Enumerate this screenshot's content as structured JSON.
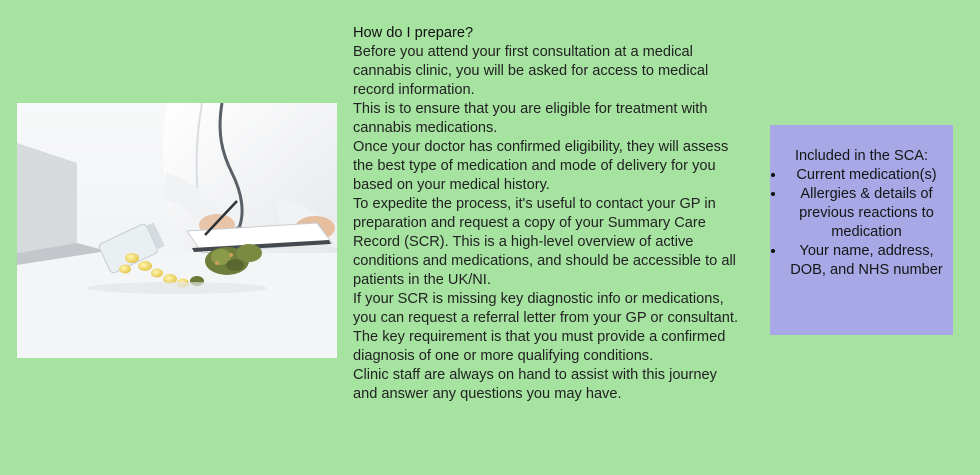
{
  "article": {
    "heading": "How do I prepare?",
    "paragraphs": [
      "Before you attend your first consultation at a medical cannabis clinic, you will be asked for access to medical record information.",
      "This is to ensure that you are eligible for treatment with cannabis medications.",
      "Once your doctor has confirmed eligibility, they will assess the best type of medication and mode of delivery for you based on your medical history.",
      "To expedite the process, it's useful to contact your GP in preparation and request a copy of your Summary Care Record (SCR). This is a high-level overview of active conditions and medications, and should be accessible to all patients in the UK/NI.",
      "If your SCR is missing key diagnostic info or medications, you can request a referral letter from your GP or consultant.",
      "The key requirement is that you must provide a confirmed diagnosis of one or more qualifying conditions.",
      "Clinic staff are always on hand to assist with this journey and answer any questions you may have."
    ]
  },
  "sca": {
    "heading": "Included in the SCA:",
    "items": [
      "Current medication(s)",
      "Allergies & details of previous reactions to medication",
      "Your name, address, DOB, and NHS number"
    ]
  },
  "colors": {
    "background": "#a6e3a1",
    "sca_box": "#a8a8e6"
  },
  "image": {
    "subject": "doctor-writing-with-cannabis-buds-and-pill-bottle"
  }
}
